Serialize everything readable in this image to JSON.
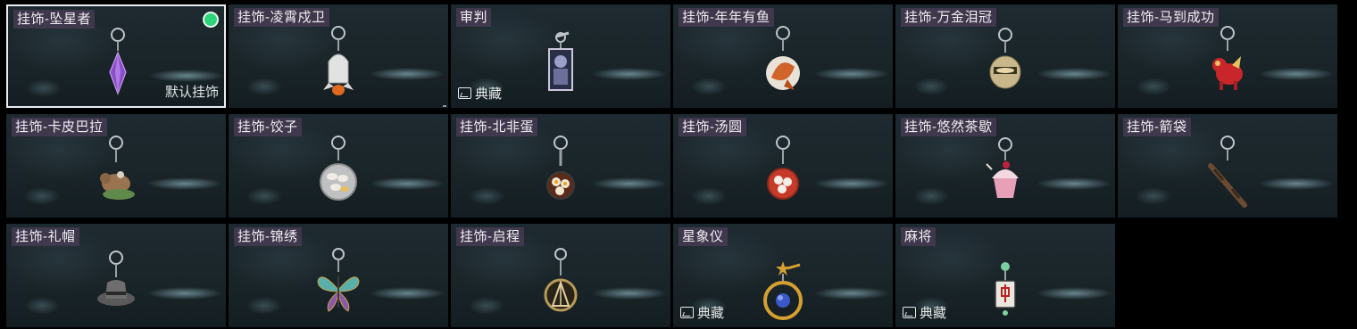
{
  "items": [
    {
      "label": "挂饰-坠星者",
      "selected": true,
      "equipped": true,
      "default_text": "默认挂饰",
      "icon": "purple-crystal-charm-icon",
      "color": "#8a4fc8"
    },
    {
      "label": "挂饰-凌霄戍卫",
      "icon": "rocket-charm-icon",
      "color": "#d9d9d9"
    },
    {
      "label": "审判",
      "collection_text": "典藏",
      "icon": "card-charm-icon",
      "color": "#9aa0c8"
    },
    {
      "label": "挂饰-年年有鱼",
      "icon": "fish-charm-icon",
      "color": "#d0642a"
    },
    {
      "label": "挂饰-万金泪冠",
      "icon": "gold-crown-charm-icon",
      "color": "#c7b78a"
    },
    {
      "label": "挂饰-马到成功",
      "icon": "red-horse-charm-icon",
      "color": "#c8262a"
    },
    {
      "label": "挂饰-卡皮巴拉",
      "icon": "capybara-charm-icon",
      "color": "#9a7350"
    },
    {
      "label": "挂饰-饺子",
      "icon": "dumpling-charm-icon",
      "color": "#d8d2c8"
    },
    {
      "label": "挂饰-北非蛋",
      "icon": "shakshuka-charm-icon",
      "color": "#c05a2a"
    },
    {
      "label": "挂饰-汤圆",
      "icon": "tangyuan-charm-icon",
      "color": "#c73a2a"
    },
    {
      "label": "挂饰-悠然茶歇",
      "icon": "cupcake-charm-icon",
      "color": "#e8a0b8"
    },
    {
      "label": "挂饰-箭袋",
      "icon": "quiver-charm-icon",
      "color": "#6a4a32"
    },
    {
      "label": "挂饰-礼帽",
      "icon": "top-hat-charm-icon",
      "color": "#6a6a6a"
    },
    {
      "label": "挂饰-锦绣",
      "icon": "butterfly-charm-icon",
      "color": "#58b0a8"
    },
    {
      "label": "挂饰-启程",
      "icon": "compass-charm-icon",
      "color": "#b89a58"
    },
    {
      "label": "星象仪",
      "collection_text": "典藏",
      "icon": "astrolabe-charm-icon",
      "color": "#d4a030"
    },
    {
      "label": "麻将",
      "collection_text": "典藏",
      "icon": "mahjong-tile-charm-icon",
      "color": "#e8e8e0"
    }
  ]
}
